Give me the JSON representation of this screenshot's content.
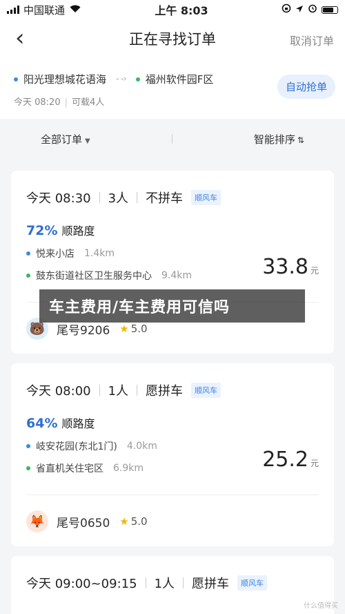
{
  "status_bar": {
    "carrier": "中国联通",
    "time": "上午 8:03"
  },
  "nav": {
    "title": "正在寻找订单",
    "cancel_label": "取消订单"
  },
  "route": {
    "from": "阳光理想城花语海",
    "to": "福州软件园F区",
    "time": "今天 08:20",
    "capacity": "可载4人",
    "auto_grab_label": "自动抢单"
  },
  "filter": {
    "all_orders": "全部订单",
    "smart_sort": "智能排序"
  },
  "orders": [
    {
      "time": "今天 08:30",
      "passengers": "3人",
      "carpool": "不拼车",
      "tag": "顺风车",
      "match_pct": "72%",
      "match_label": "顺路度",
      "pickup": "悦来小店",
      "pickup_dist": "1.4km",
      "dropoff": "鼓东街道社区卫生服务中心",
      "dropoff_dist": "9.4km",
      "price": "33.8",
      "unit": "元",
      "plate": "尾号9206",
      "rating": "5.0"
    },
    {
      "time": "今天 08:00",
      "passengers": "1人",
      "carpool": "愿拼车",
      "tag": "顺风车",
      "match_pct": "64%",
      "match_label": "顺路度",
      "pickup": "岐安花园(东北1门)",
      "pickup_dist": "4.0km",
      "dropoff": "省直机关住宅区",
      "dropoff_dist": "6.9km",
      "price": "25.2",
      "unit": "元",
      "plate": "尾号0650",
      "rating": "5.0"
    },
    {
      "time": "今天 09:00~09:15",
      "passengers": "1人",
      "carpool": "愿拼车",
      "tag": "顺风车"
    }
  ],
  "overlay_text": "车主费用/车主费用可信吗",
  "watermark": "什么值得买",
  "colors": {
    "accent": "#2f6fd6",
    "pickup_dot": "#3b8be7",
    "dropoff_dot": "#3cb563",
    "star": "#f5b400"
  }
}
